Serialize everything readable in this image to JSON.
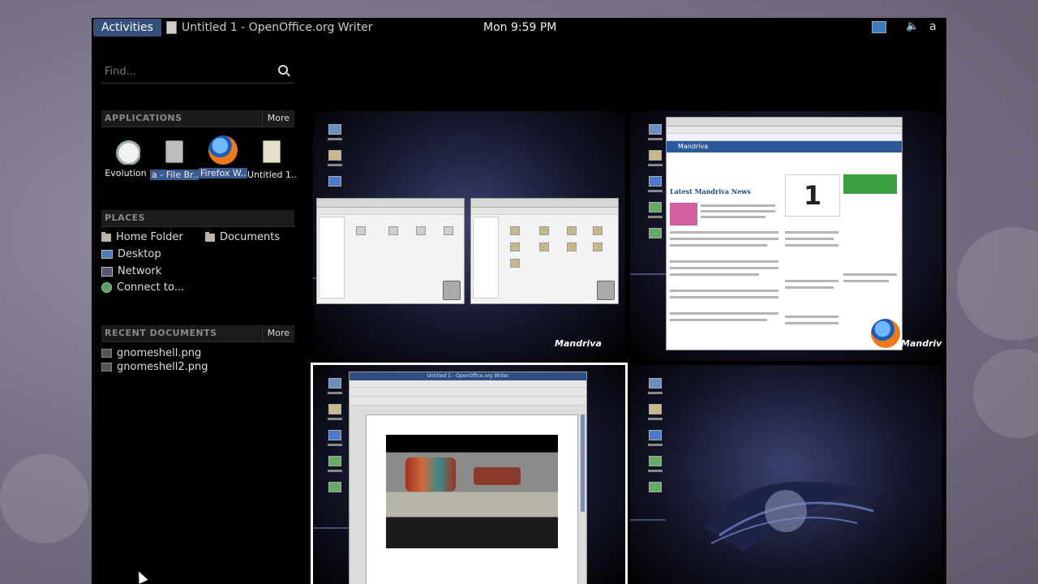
{
  "topbar": {
    "activities_label": "Activities",
    "app_menu_label": "Untitled 1 - OpenOffice.org Writer",
    "clock": "Mon  9:59 PM",
    "user_label": "a",
    "icons": [
      "display-icon",
      "volume-icon"
    ]
  },
  "search": {
    "placeholder": "Find..."
  },
  "applications": {
    "header": "APPLICATIONS",
    "more_label": "More",
    "items": [
      {
        "label": "Evolution",
        "icon": "clock-icon"
      },
      {
        "label": "a - File Br...",
        "icon": "file-cabinet-icon"
      },
      {
        "label": "Firefox W...",
        "icon": "firefox-icon"
      },
      {
        "label": "Untitled 1...",
        "icon": "document-icon"
      }
    ]
  },
  "places": {
    "header": "PLACES",
    "items": [
      {
        "label": "Home Folder",
        "icon": "folder-icon"
      },
      {
        "label": "Documents",
        "icon": "folder-icon"
      },
      {
        "label": "Desktop",
        "icon": "monitor-icon"
      },
      {
        "label": "Network",
        "icon": "network-icon"
      },
      {
        "label": "Connect to...",
        "icon": "globe-icon"
      }
    ]
  },
  "recent": {
    "header": "RECENT DOCUMENTS",
    "more_label": "More",
    "items": [
      {
        "label": "gnomeshell.png"
      },
      {
        "label": "gnomeshell2.png"
      }
    ]
  },
  "workspaces": {
    "brand": "Mandriva",
    "writer_title": "Untitled 1 - OpenOffice.org Writer",
    "browser_heading": "Mandriva",
    "browser_news": "Latest Mandriva News",
    "browser_big_number": "1"
  },
  "colors": {
    "activities_bg": "#34507a",
    "panel_bg": "#000000",
    "highlight": "#3b5a8e"
  }
}
